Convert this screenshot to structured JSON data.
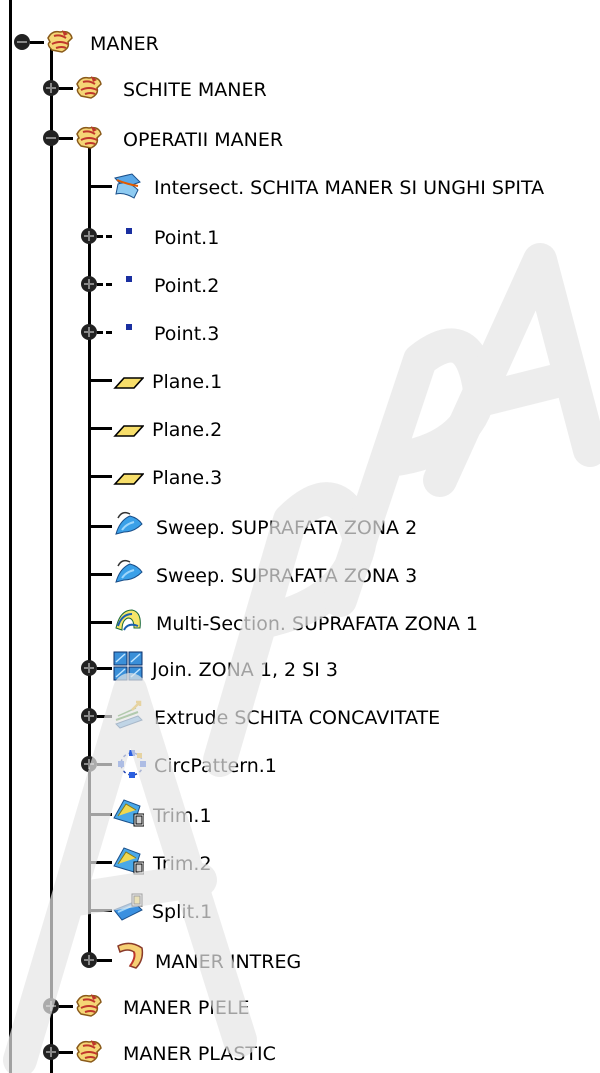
{
  "tree": {
    "root": {
      "label": "MANER",
      "icon": "product-icon",
      "expanded": true
    },
    "children": [
      {
        "label": "SCHITE MANER",
        "icon": "product-icon",
        "expanded": false
      },
      {
        "label": "OPERATII MANER",
        "icon": "product-icon",
        "expanded": true,
        "children": [
          {
            "label": "Intersect. SCHITA MANER SI UNGHI SPITA",
            "icon": "intersect-icon"
          },
          {
            "label": "Point.1",
            "icon": "point-icon",
            "expander": "plus"
          },
          {
            "label": "Point.2",
            "icon": "point-icon",
            "expander": "plus"
          },
          {
            "label": "Point.3",
            "icon": "point-icon",
            "expander": "plus"
          },
          {
            "label": "Plane.1",
            "icon": "plane-icon"
          },
          {
            "label": "Plane.2",
            "icon": "plane-icon"
          },
          {
            "label": "Plane.3",
            "icon": "plane-icon"
          },
          {
            "label": "Sweep. SUPRAFATA ZONA 2",
            "icon": "sweep-icon"
          },
          {
            "label": "Sweep. SUPRAFATA ZONA 3",
            "icon": "sweep-icon"
          },
          {
            "label": "Multi-Section. SUPRAFATA ZONA 1",
            "icon": "multisection-icon"
          },
          {
            "label": "Join. ZONA 1, 2 SI 3",
            "icon": "join-icon",
            "expander": "plus"
          },
          {
            "label": "Extrude SCHITA CONCAVITATE",
            "icon": "extrude-icon",
            "expander": "plus"
          },
          {
            "label": "CircPattern.1",
            "icon": "circpattern-icon",
            "expander": "plus"
          },
          {
            "label": "Trim.1",
            "icon": "trim-icon"
          },
          {
            "label": "Trim.2",
            "icon": "trim-icon"
          },
          {
            "label": "Split.1",
            "icon": "split-icon"
          },
          {
            "label": "MANER INTREG",
            "icon": "solid-icon",
            "expander": "plus"
          }
        ]
      },
      {
        "label": "MANER PIELE",
        "icon": "product-icon",
        "expanded": false
      },
      {
        "label": "MANER PLASTIC",
        "icon": "product-icon",
        "expanded": false
      }
    ]
  },
  "watermark": {
    "text": "ARPPA"
  }
}
